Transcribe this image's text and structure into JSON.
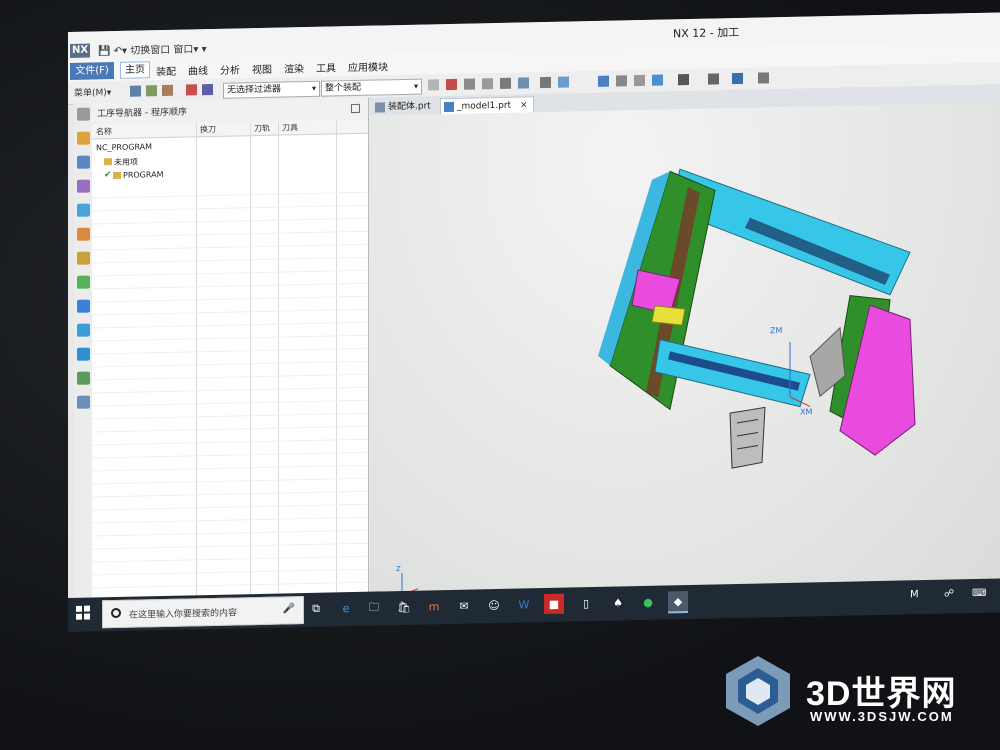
{
  "window": {
    "title": "NX 12 - 加工",
    "quick_access": "切换窗口 窗口▾ ▾",
    "logo": "NX"
  },
  "menu": {
    "file": "文件(F)",
    "items": [
      "主页",
      "装配",
      "曲线",
      "分析",
      "视图",
      "渲染",
      "工具",
      "应用模块"
    ]
  },
  "toolbar": {
    "menu_label": "菜单(M)▾",
    "filter_select": "无选择过滤器",
    "scope_select": "整个装配"
  },
  "navigator": {
    "title": "工序导航器 - 程序顺序",
    "columns": [
      "名称",
      "换刀",
      "刀轨",
      "刀具"
    ],
    "rows": [
      {
        "label": "NC_PROGRAM"
      },
      {
        "label": "未用项"
      },
      {
        "label": "PROGRAM"
      }
    ]
  },
  "tabs": [
    {
      "label": "装配体.prt"
    },
    {
      "label": "_model1.prt",
      "close": "×"
    }
  ],
  "viewport": {
    "axis_labels": [
      "ZM",
      "XM"
    ],
    "triad_label": "Z"
  },
  "taskbar": {
    "search_placeholder": "在这里输入你要搜索的内容",
    "tray_m": "M",
    "tray_keyboard": "⌨"
  },
  "watermark": {
    "brand": "3D世界网",
    "url": "WWW.3DSJW.COM"
  },
  "colors": {
    "accent": "#4a79b8",
    "green": "#2f8f2a",
    "cyan": "#35c6e8",
    "magenta": "#e84bde",
    "yellow": "#e8e03a"
  }
}
